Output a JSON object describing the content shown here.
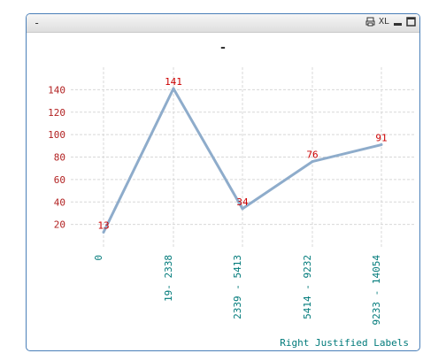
{
  "window": {
    "title_dash": "-",
    "control_xl": "XL"
  },
  "chart_data": {
    "type": "line",
    "title": "-",
    "categories": [
      "0",
      "19- 2338",
      "2339 - 5413",
      "5414 - 9232",
      "9233 - 14054"
    ],
    "values": [
      13,
      141,
      34,
      76,
      91
    ],
    "ylim": [
      0,
      160
    ],
    "yticks": [
      20,
      40,
      60,
      80,
      100,
      120,
      140
    ],
    "grid": true,
    "line_color": "#8eaccb",
    "footer": "Right Justified Labels"
  }
}
